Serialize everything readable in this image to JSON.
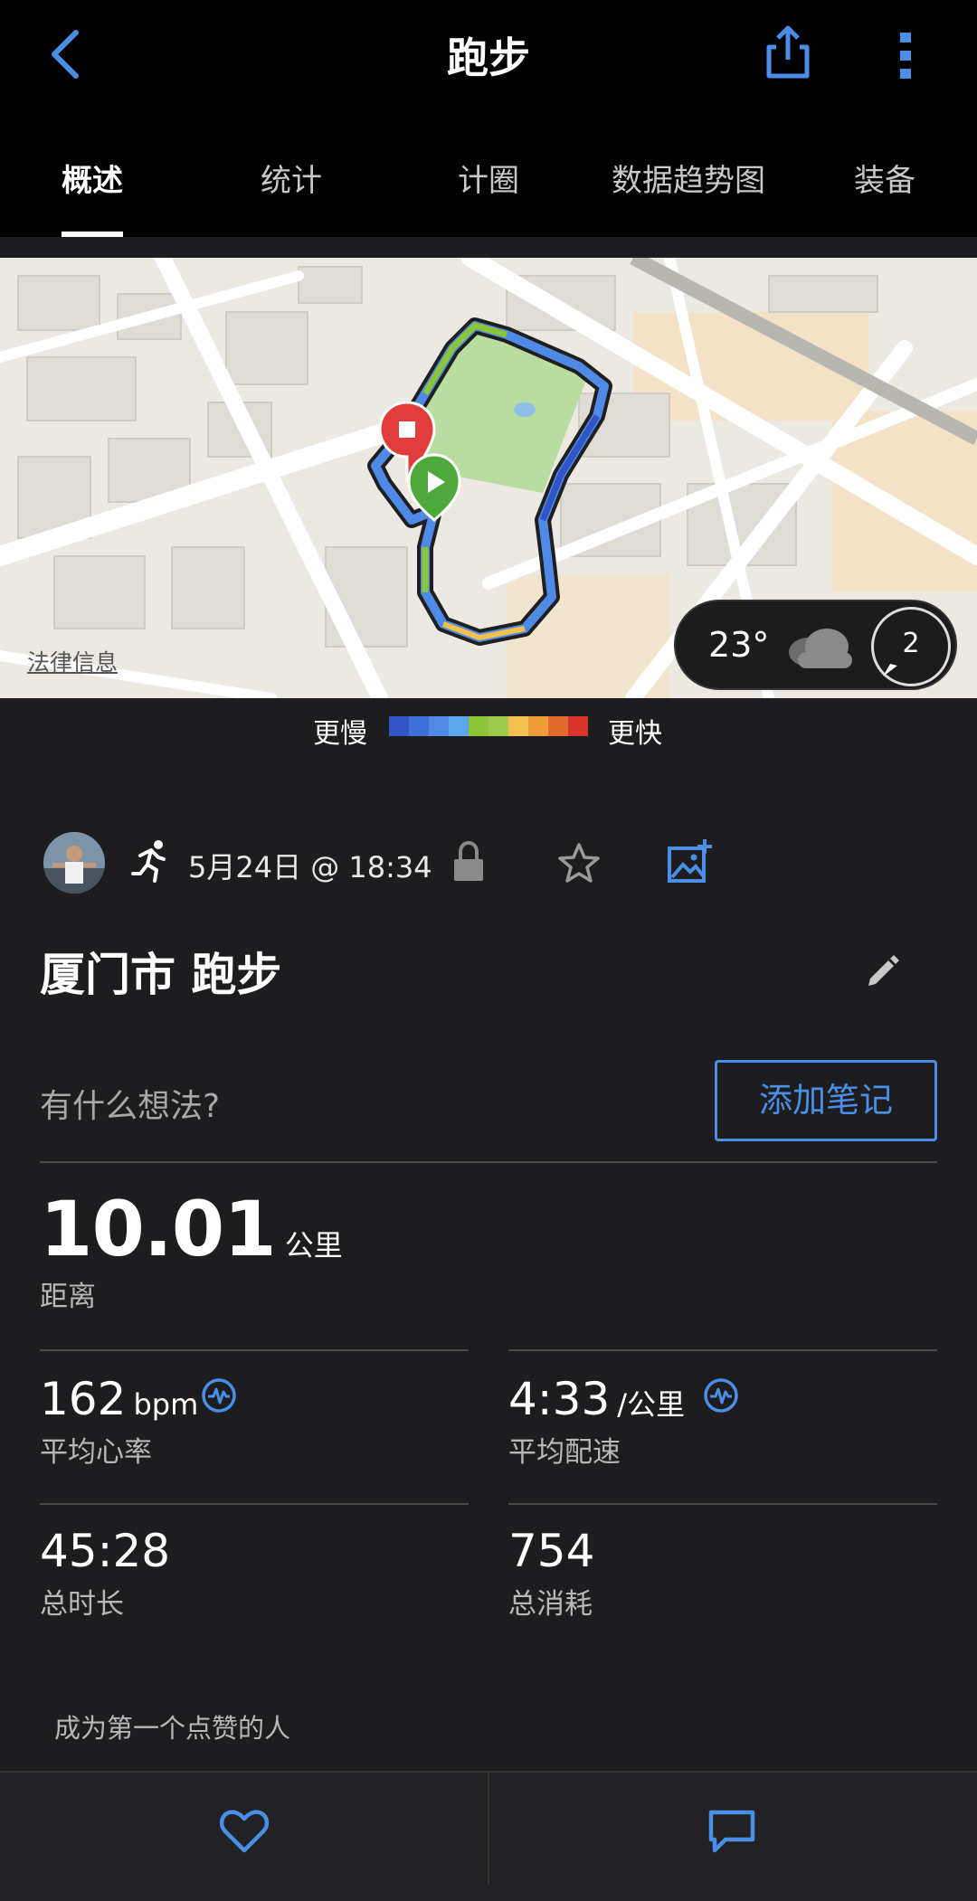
{
  "header": {
    "title": "跑步",
    "back_icon": "chevron-left-icon",
    "share_icon": "share-icon",
    "more_icon": "more-vertical-icon"
  },
  "tabs": [
    {
      "label": "概述",
      "active": true
    },
    {
      "label": "统计",
      "active": false
    },
    {
      "label": "计圈",
      "active": false
    },
    {
      "label": "数据趋势图",
      "active": false
    },
    {
      "label": "装备",
      "active": false
    }
  ],
  "map": {
    "legal_link": "法律信息",
    "weather": {
      "temperature": "23°",
      "condition_icon": "cloud-icon",
      "wind_speed": "2"
    }
  },
  "pace_legend": {
    "slow_label": "更慢",
    "fast_label": "更快",
    "colors": [
      "#2f56c4",
      "#3d6fd6",
      "#4f8ae6",
      "#5aa8ea",
      "#8cc43a",
      "#9ccc4a",
      "#f2c14e",
      "#ee9b3a",
      "#e36a2e",
      "#d8342c"
    ]
  },
  "activity": {
    "type_icon": "running-icon",
    "date": "5月24日 @ 18:34",
    "title": "厦门市 跑步",
    "thoughts_placeholder": "有什么想法?",
    "add_note_label": "添加笔记"
  },
  "stats": {
    "distance": {
      "value": "10.01",
      "unit": "公里",
      "label": "距离"
    },
    "avg_hr": {
      "value": "162",
      "unit": "bpm",
      "label": "平均心率"
    },
    "avg_pace": {
      "value": "4:33",
      "unit": "/公里",
      "label": "平均配速"
    },
    "duration": {
      "value": "45:28",
      "label": "总时长"
    },
    "calories": {
      "value": "754",
      "label": "总消耗"
    }
  },
  "social": {
    "first_like_text": "成为第一个点赞的人"
  },
  "colors": {
    "accent": "#4a8ee8",
    "background": "#1d1d1f",
    "header_bg": "#000000"
  }
}
